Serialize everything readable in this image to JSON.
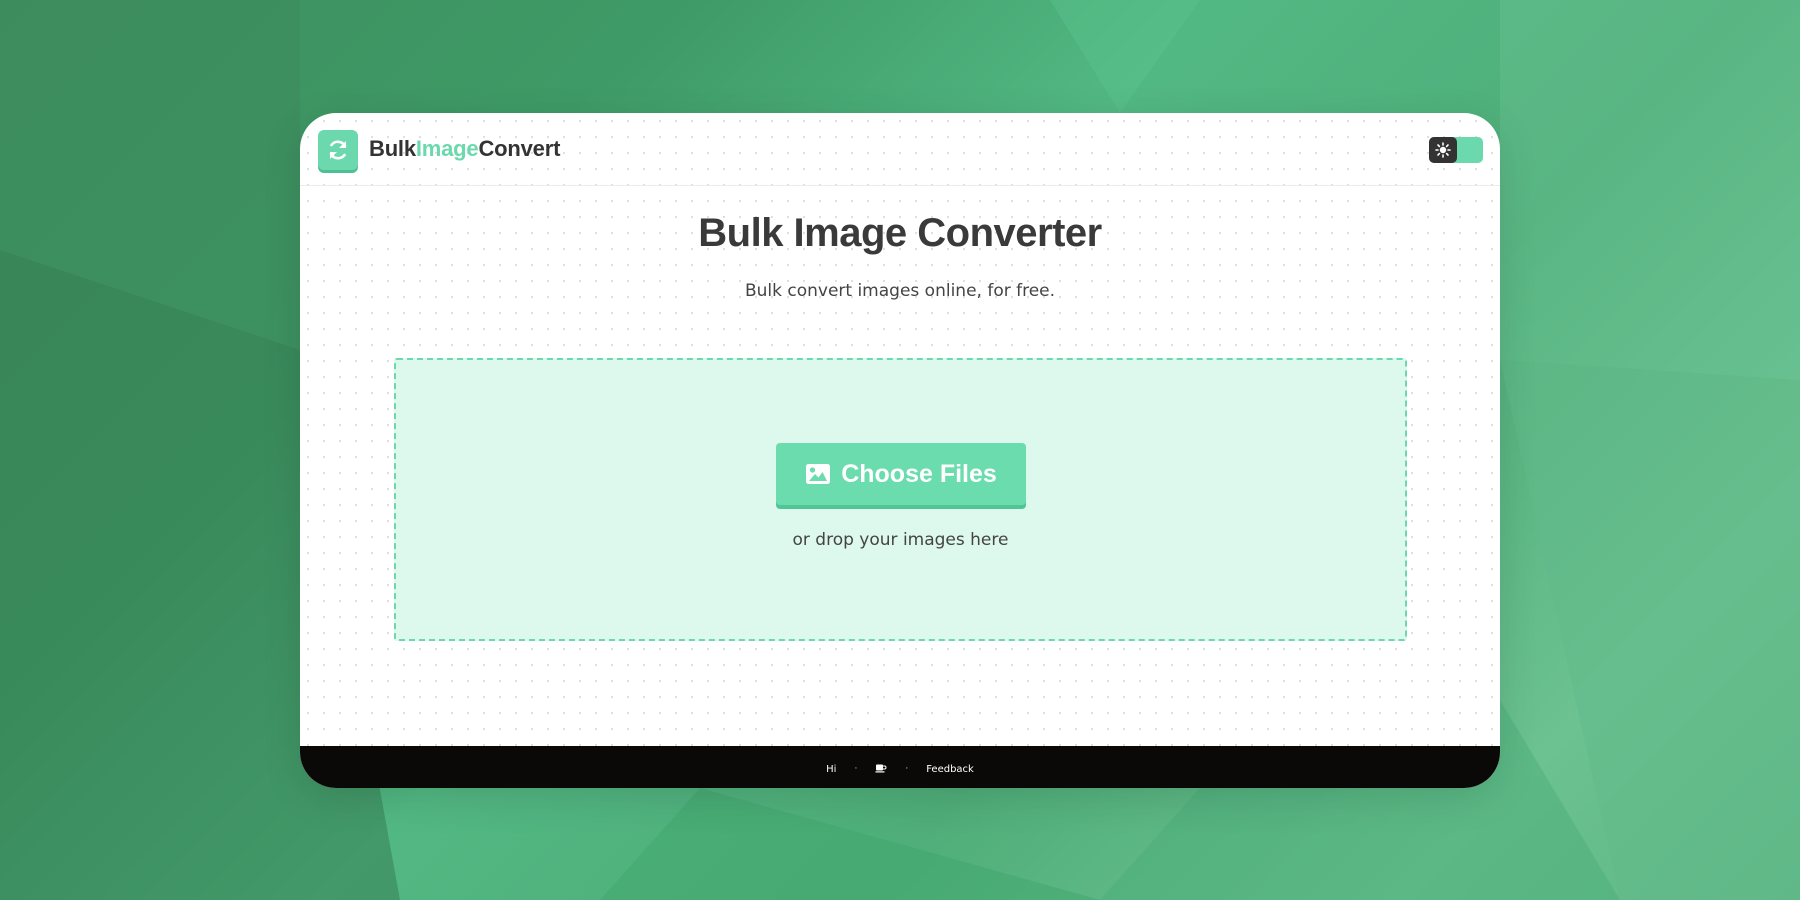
{
  "brand": {
    "name_part1": "Bulk",
    "name_part2": "Image",
    "name_part3": "Convert",
    "logo_icon": "refresh-icon"
  },
  "theme_toggle": {
    "icon": "sun-icon"
  },
  "hero": {
    "title": "Bulk Image Converter",
    "subtitle": "Bulk convert images online, for free."
  },
  "dropzone": {
    "button_label": "Choose Files",
    "button_icon": "image-icon",
    "hint": "or drop your images here"
  },
  "footer": {
    "hi_label": "Hi",
    "separator": "·",
    "coffee_icon": "coffee-icon",
    "feedback_label": "Feedback"
  },
  "colors": {
    "accent": "#6bd9ad",
    "text_dark": "#3a3a3a",
    "dropzone_bg": "#ddf8ec",
    "footer_bg": "#0b0908"
  }
}
